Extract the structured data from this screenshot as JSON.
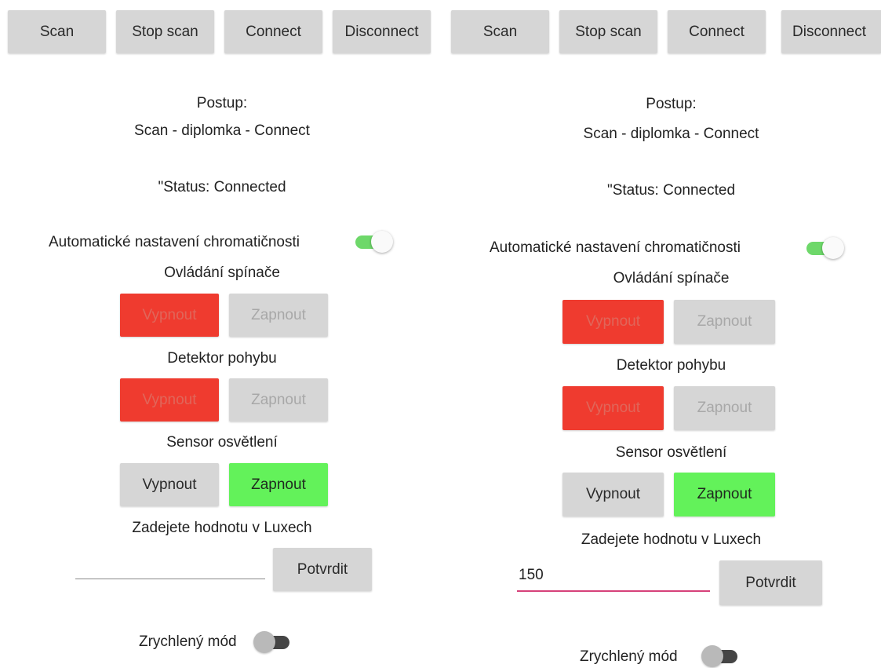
{
  "screens": [
    {
      "toolbar": {
        "scan": "Scan",
        "stop_scan": "Stop scan",
        "connect": "Connect",
        "disconnect": "Disconnect"
      },
      "procedure_label": "Postup:",
      "procedure_steps": "Scan - diplomka - Connect",
      "status": "\"Status: Connected",
      "auto_chroma": {
        "label": "Automatické nastavení chromatičnosti",
        "on": true
      },
      "switch_control": {
        "title": "Ovládání spínače",
        "off_label": "Vypnout",
        "on_label": "Zapnout"
      },
      "motion_detector": {
        "title": "Detektor pohybu",
        "off_label": "Vypnout",
        "on_label": "Zapnout"
      },
      "light_sensor": {
        "title": "Sensor osvětlení",
        "off_label": "Vypnout",
        "on_label": "Zapnout"
      },
      "lux_input": {
        "label": "Zadejete hodnotu v Luxech",
        "value": "",
        "confirm_label": "Potvrdit"
      },
      "fast_mode": {
        "label": "Zrychlený mód",
        "on": false
      }
    },
    {
      "toolbar": {
        "scan": "Scan",
        "stop_scan": "Stop scan",
        "connect": "Connect",
        "disconnect": "Disconnect"
      },
      "procedure_label": "Postup:",
      "procedure_steps": "Scan - diplomka - Connect",
      "status": "\"Status: Connected",
      "auto_chroma": {
        "label": "Automatické nastavení chromatičnosti",
        "on": true
      },
      "switch_control": {
        "title": "Ovládání spínače",
        "off_label": "Vypnout",
        "on_label": "Zapnout"
      },
      "motion_detector": {
        "title": "Detektor pohybu",
        "off_label": "Vypnout",
        "on_label": "Zapnout"
      },
      "light_sensor": {
        "title": "Sensor osvětlení",
        "off_label": "Vypnout",
        "on_label": "Zapnout"
      },
      "lux_input": {
        "label": "Zadejete hodnotu v Luxech",
        "value": "150",
        "confirm_label": "Potvrdit"
      },
      "fast_mode": {
        "label": "Zrychlený mód",
        "on": false
      }
    }
  ],
  "colors": {
    "button_grey": "#d6d6d6",
    "button_red": "#ef3b2f",
    "button_green": "#63f25a",
    "switch_on": "#6ed86a",
    "input_focus": "#d6417a",
    "input_idle": "#8a8a8a"
  }
}
